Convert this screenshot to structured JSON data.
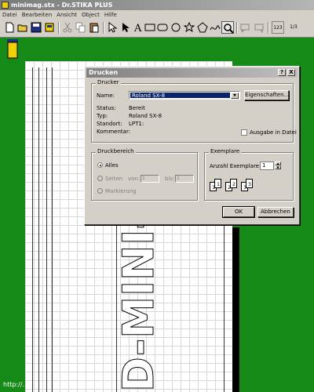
{
  "app": {
    "title": "minimag.stx - Dr.STIKA PLUS"
  },
  "menu": [
    "Datei",
    "Bearbeiten",
    "Ansicht",
    "Object",
    "Hilfe"
  ],
  "toolbar": {
    "icons": [
      "new-file-icon",
      "open-folder-icon",
      "save-icon",
      "print-icon",
      "cut-icon",
      "copy-icon",
      "paste-icon",
      "select-arrow-icon",
      "node-edit-icon",
      "text-tool-icon",
      "rectangle-icon",
      "rounded-rectangle-icon",
      "ellipse-icon",
      "star-icon",
      "polygon-icon",
      "freehand-icon",
      "zoom-icon",
      "message-icon",
      "speech-icon",
      "numbering-icon",
      "fraction-icon"
    ],
    "numbering_label": "123",
    "fraction_label": "1/3"
  },
  "canvas": {
    "text": "D-MINI-"
  },
  "watermark": "http://...",
  "dialog": {
    "title": "Drucken",
    "help_btn": "?",
    "close_btn": "X",
    "printer_group": "Drucker",
    "name_label": "Name:",
    "name_value": "Roland SX-8",
    "properties_btn": "Eigenschaften...",
    "status_label": "Status:",
    "status_value": "Bereit",
    "type_label": "Typ:",
    "type_value": "Roland SX-8",
    "location_label": "Standort:",
    "location_value": "LPT1:",
    "comment_label": "Kommentar:",
    "print_to_file": "Ausgabe in Datei",
    "range_group": "Druckbereich",
    "all": "Alles",
    "pages": "Seiten",
    "from": "von:",
    "from_value": "1",
    "to": "bis:",
    "to_value": "1",
    "selection": "Markierung",
    "copies_group": "Exemplare",
    "copies_label": "Anzahl Exemplare:",
    "copies_value": "1",
    "collate_pages": [
      "1",
      "1",
      "2",
      "2",
      "3",
      "3"
    ],
    "ok_btn": "OK",
    "cancel_btn": "Abbrechen"
  }
}
